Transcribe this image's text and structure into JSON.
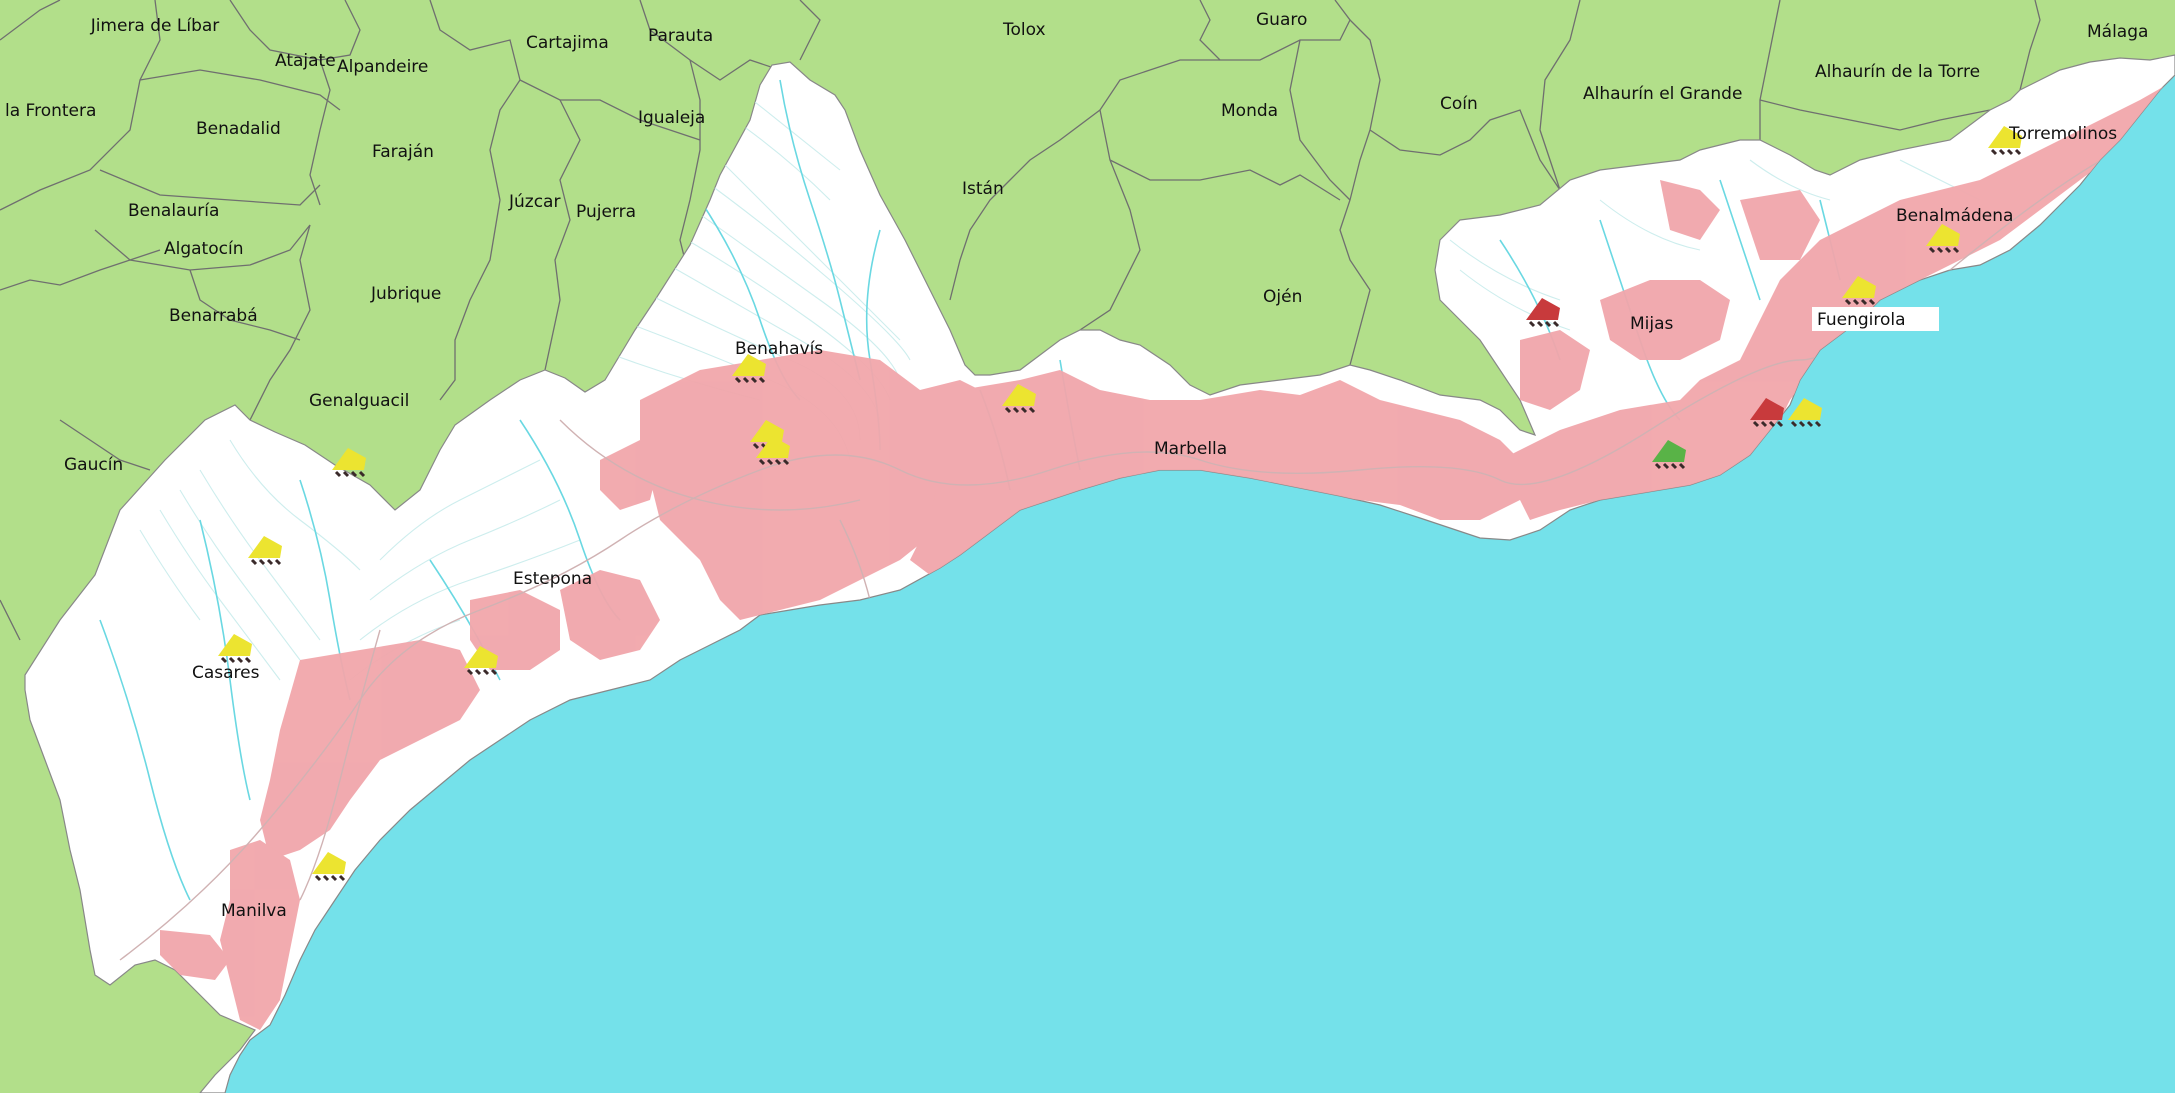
{
  "map": {
    "colors": {
      "sea": "#74e1ea",
      "outside_land": "#b2df8a",
      "study_area": "#ffffff",
      "urban": "#f1a6ab",
      "rivers": "#6ad8e2",
      "contours": "#c8ecec",
      "roads": "#e7c6c7",
      "boundaries": "#6f6f6f",
      "marker_yellow": "#ece430",
      "marker_red": "#c83a3c",
      "marker_green": "#59b347"
    },
    "labels": {
      "jimera_de_libar": "Jimera de Líbar",
      "atajate": "Atajate",
      "alpandeire": "Alpandeire",
      "cartajima": "Cartajima",
      "parauta": "Parauta",
      "tolox": "Tolox",
      "guaro": "Guaro",
      "malaga": "Málaga",
      "la_frontera": "la Frontera",
      "benadalid": "Benadalid",
      "farajan": "Faraján",
      "igualeja": "Igualeja",
      "monda": "Monda",
      "coin": "Coín",
      "alhaurin_el_grande": "Alhaurín el Grande",
      "alhaurin_de_la_torre": "Alhaurín de la Torre",
      "torremolinos": "Torremolinos",
      "benalauria": "Benalauría",
      "juzcar": "Júzcar",
      "pujerra": "Pujerra",
      "istan": "Istán",
      "benalmadena": "Benalmádena",
      "algatocin": "Algatocín",
      "jubrique": "Jubrique",
      "ojen": "Ojén",
      "benarraba": "Benarrabá",
      "benahavis": "Benahavís",
      "mijas": "Mijas",
      "fuengirola": "Fuengirola",
      "genalguacil": "Genalguacil",
      "marbella": "Marbella",
      "gaucin": "Gaucín",
      "estepona": "Estepona",
      "casares": "Casares",
      "manilva": "Manilva"
    }
  }
}
